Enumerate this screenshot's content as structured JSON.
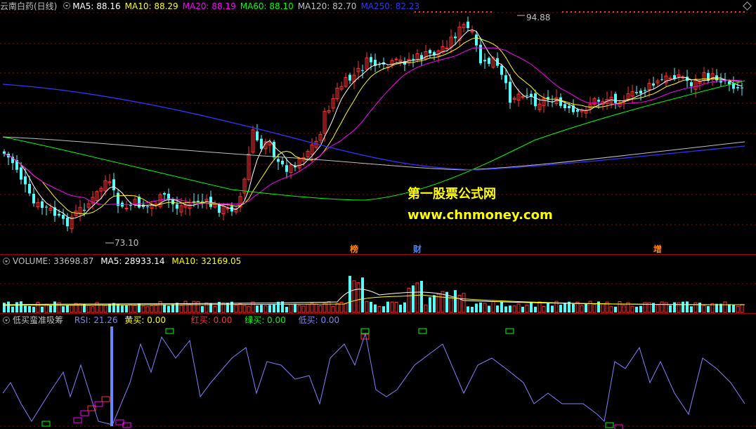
{
  "main_panel": {
    "title": "云南白药(日线)",
    "ma": [
      {
        "label": "MA5: 88.16",
        "color": "#ffffff"
      },
      {
        "label": "MA10: 88.29",
        "color": "#ffff00"
      },
      {
        "label": "MA20: 88.19",
        "color": "#ff00ff"
      },
      {
        "label": "MA60: 88.10",
        "color": "#00ff00"
      },
      {
        "label": "MA120: 82.70",
        "color": "#c0c0c0"
      },
      {
        "label": "MA250: 82.23",
        "color": "#3333ff"
      }
    ],
    "high_label": "94.88",
    "low_label": "73.10",
    "markers": [
      {
        "text": "榜",
        "color": "#ff8800"
      },
      {
        "text": "财",
        "color": "#4488ff"
      },
      {
        "text": "增",
        "color": "#ff8800"
      }
    ],
    "watermark_cn": "第一股票公式网",
    "watermark_url": "www.chnmoney.com"
  },
  "volume_panel": {
    "volume": "VOLUME: 33698.87",
    "ma5": "MA5: 28933.14",
    "ma10": "MA10: 32169.05"
  },
  "indicator_panel": {
    "name": "低买蛮准吸筹",
    "rsi": "RSI: 21.26",
    "yellow_buy": "黄买: 0.00",
    "red_buy": "红买: 0.00",
    "green_buy": "绿买: 0.00",
    "low_buy": "低买: 0.00"
  },
  "colors": {
    "up": "#ff3232",
    "down": "#54fcfc",
    "rsi": "#8080ff",
    "grid": "#a00000"
  },
  "chart_data": {
    "type": "candlestick",
    "symbol": "云南白药",
    "period": "日线",
    "price_high": 94.88,
    "price_low": 73.1,
    "close_ma": {
      "MA5": 88.16,
      "MA10": 88.29,
      "MA20": 88.19,
      "MA60": 88.1,
      "MA120": 82.7,
      "MA250": 82.23
    },
    "volume_last": 33698.87,
    "rsi_last": 21.26
  }
}
